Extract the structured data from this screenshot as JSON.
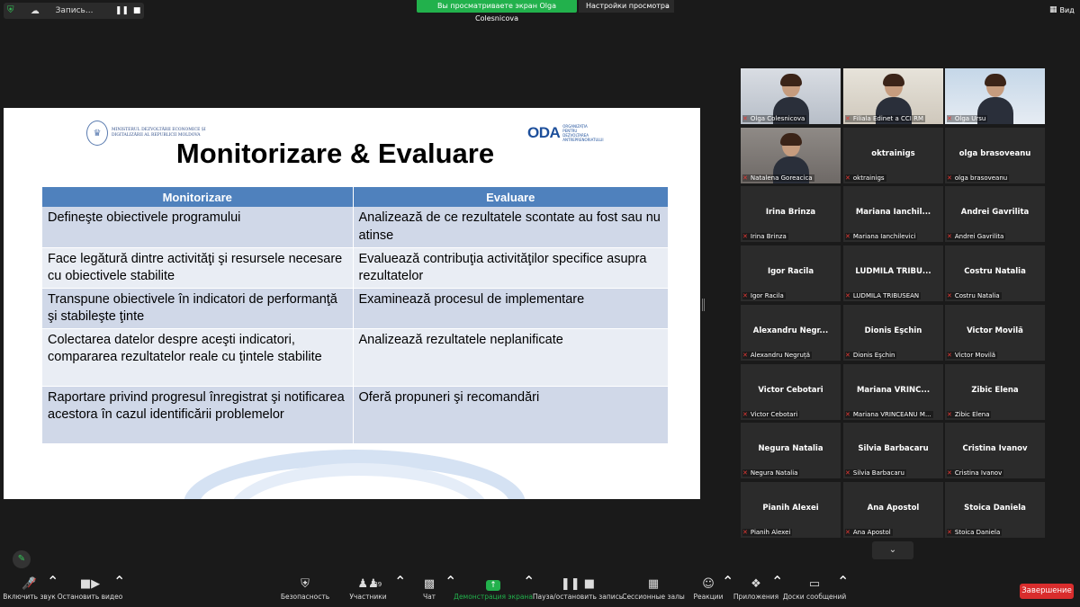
{
  "top": {
    "recording_label": "Запись...",
    "share_banner": "Вы просматриваете экран Olga Colesnicova",
    "view_settings": "Настройки просмотра",
    "view_button": "Вид"
  },
  "slide": {
    "ministry_text": "MINISTERUL DEZVOLTĂRII ECONOMICE ȘI DIGITALIZĂRII AL REPUBLICII MOLDOVA",
    "oda_logo": "ODA",
    "oda_text": "ORGANIZAȚIA PENTRU DEZVOLTAREA ANTREPRENORIATULUI",
    "title": "Monitorizare & Evaluare",
    "headers": [
      "Monitorizare",
      "Evaluare"
    ],
    "rows": [
      [
        "Defineşte obiectivele programului",
        "Analizează de ce rezultatele scontate au fost sau nu atinse"
      ],
      [
        "Face legătură dintre activităţi şi resursele necesare cu obiectivele stabilite",
        "Evaluează contribuţia activităţilor specifice asupra rezultatelor"
      ],
      [
        "Transpune obiectivele în indicatori de performanţă şi stabileşte ţinte",
        "Examinează procesul de implementare"
      ],
      [
        "Colectarea datelor despre aceşti indicatori, compararea rezultatelor reale cu ţintele stabilite",
        "Analizează rezultatele neplanificate"
      ],
      [
        "Raportare privind progresul înregistrat şi notificarea acestora  în cazul identificării problemelor",
        "Oferă propuneri şi recomandări"
      ]
    ]
  },
  "participants": [
    {
      "big": "",
      "small": "Olga Colesnicova",
      "video": true,
      "active": true
    },
    {
      "big": "",
      "small": "Filiala Edinet a CCI RM",
      "video": true,
      "active": false
    },
    {
      "big": "",
      "small": "Olga Ursu",
      "video": true,
      "active": false
    },
    {
      "big": "",
      "small": "Natalena Goreacica",
      "video": true,
      "active": false
    },
    {
      "big": "oktrainigs",
      "small": "oktrainigs",
      "video": false,
      "active": false
    },
    {
      "big": "olga brasoveanu",
      "small": "olga brasoveanu",
      "video": false,
      "active": false
    },
    {
      "big": "Irina Brinza",
      "small": "Irina Brinza",
      "video": false,
      "active": false
    },
    {
      "big": "Mariana  Ianchil...",
      "small": "Mariana Ianchilevici",
      "video": false,
      "active": false
    },
    {
      "big": "Andrei Gavrilita",
      "small": "Andrei Gavrilita",
      "video": false,
      "active": false
    },
    {
      "big": "Igor Racila",
      "small": "Igor Racila",
      "video": false,
      "active": false
    },
    {
      "big": "LUDMILA TRIBU...",
      "small": "LUDMILA TRIBUSEAN",
      "video": false,
      "active": false
    },
    {
      "big": "Costru Natalia",
      "small": "Costru Natalia",
      "video": false,
      "active": false
    },
    {
      "big": "Alexandru  Negr...",
      "small": "Alexandru Negruță",
      "video": false,
      "active": false
    },
    {
      "big": "Dionis Eşchin",
      "small": "Dionis Eşchin",
      "video": false,
      "active": false
    },
    {
      "big": "Victor Movilă",
      "small": "Victor Movilă",
      "video": false,
      "active": false
    },
    {
      "big": "Victor Cebotari",
      "small": "Victor Cebotari",
      "video": false,
      "active": false
    },
    {
      "big": "Mariana  VRINC...",
      "small": "Mariana VRINCEANU M...",
      "video": false,
      "active": false
    },
    {
      "big": "Zibic Elena",
      "small": "Zibic Elena",
      "video": false,
      "active": false
    },
    {
      "big": "Negura Natalia",
      "small": "Negura Natalia",
      "video": false,
      "active": false
    },
    {
      "big": "Silvia Barbacaru",
      "small": "Silvia Barbacaru",
      "video": false,
      "active": false
    },
    {
      "big": "Cristina Ivanov",
      "small": "Cristina Ivanov",
      "video": false,
      "active": false
    },
    {
      "big": "Pianih Alexei",
      "small": "Pianih Alexei",
      "video": false,
      "active": false
    },
    {
      "big": "Ana Apostol",
      "small": "Ana Apostol",
      "video": false,
      "active": false
    },
    {
      "big": "Stoica Daniela",
      "small": "Stoica Daniela",
      "video": false,
      "active": false
    }
  ],
  "toolbar": {
    "unmute": "Включить звук",
    "stop_video": "Остановить видео",
    "security": "Безопасность",
    "participants": "Участники",
    "participants_count": "39",
    "chat": "Чат",
    "share_screen": "Демонстрация экрана",
    "pause_recording": "Пауза/остановить запись",
    "breakout_rooms": "Сессионные залы",
    "reactions": "Реакции",
    "apps": "Приложения",
    "whiteboards": "Доски сообщений",
    "end": "Завершение"
  },
  "colors": {
    "share_green": "#22b14c",
    "end_red": "#d92d2d",
    "table_header": "#4f81bd",
    "active_speaker": "#c9e34a"
  }
}
